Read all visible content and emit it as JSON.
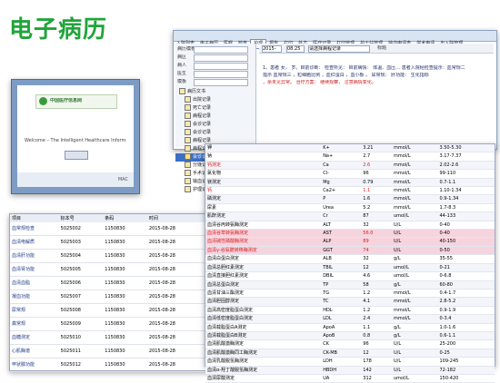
{
  "title": "电子病历",
  "topwin": {
    "menu": [
      "入院列表",
      "电子病历",
      "医嘱",
      "检查",
      "护理",
      "报告",
      "打印",
      "处方",
      "医疗记录",
      "打印管理",
      "护士站管理",
      "输血申请表",
      "学术申请",
      "出入院管理"
    ],
    "left_labels": [
      "病历模板",
      "病区",
      "病人",
      "医生",
      "模板"
    ],
    "tree": [
      "病历文书",
      "出院记录",
      "死亡记录",
      "病程记录",
      "会诊记录",
      "会诊记录",
      "病程记录",
      "病程记录",
      "会诊记录",
      "分娩记录",
      "手术记录",
      "输血记录",
      "护理记录"
    ],
    "doc_date1": "2015-",
    "doc_date2": "08:25",
    "doc_select": "请选择病程记录",
    "doc_right_label": "标题",
    "doc_line1": "1、患者  女，  岁。目前诊断：  检查所见：  目前病情：  体温、血压…  患者入院经检查提示：血常规二",
    "doc_line2": "指示 血常规三  ，粒细胞比例  ，血红蛋白  ，血小板  。  尿常规：  肝功能：  生化指标",
    "doc_line3": "  ，余未见异常。  治疗方案：  继续观察，  注意病情变化。"
  },
  "screenshot": {
    "brand": "中国医疗信息网",
    "caption": "Welcome – The Intelligent Healthcare Information",
    "footer": "MAC"
  },
  "right_table": {
    "rows": [
      [
        "钾",
        "K+",
        "3.21",
        "mmol/L",
        "3.50-5.30",
        false,
        false
      ],
      [
        "钠",
        "Na+",
        "2.7",
        "mmol/L",
        "3.17-7.37",
        false,
        false
      ],
      [
        "钙测定",
        "Ca",
        "2.6",
        "mmol/L",
        "2.02-2.6",
        true,
        false
      ],
      [
        "氯化物",
        "Cl-",
        "96",
        "mmol/L",
        "99-110",
        false,
        false
      ],
      [
        "镁测定",
        "Mg",
        "0.79",
        "mmol/L",
        "0.7-1.1",
        false,
        false
      ],
      [
        "钙",
        "Ca2+",
        "1.1",
        "mmol/L",
        "1.10-1.34",
        true,
        false
      ],
      [
        "磷测定",
        "P",
        "1.6",
        "mmol/L",
        "0.9-1.34",
        false,
        false
      ],
      [
        "尿素",
        "Urea",
        "5.2",
        "mmol/L",
        "1.7-8.3",
        false,
        false
      ],
      [
        "肌酐测定",
        "Cr",
        "87",
        "umol/L",
        "44-133",
        false,
        false
      ],
      [
        "血清谷丙转氨酶测定",
        "ALT",
        "32",
        "U/L",
        "0-40",
        false,
        false
      ],
      [
        "血清谷草转氨酶测定",
        "AST",
        "56.0",
        "U/L",
        "0-40",
        true,
        true
      ],
      [
        "血清碱性磷酸酶测定",
        "ALP",
        "89",
        "U/L",
        "40-150",
        true,
        true
      ],
      [
        "血清γ-谷氨酰转移酶测定",
        "GGT",
        "74",
        "U/L",
        "0-50",
        true,
        true
      ],
      [
        "血清白蛋白测定",
        "ALB",
        "32",
        "g/L",
        "35-55",
        false,
        false
      ],
      [
        "血清总胆红素测定",
        "TBIL",
        "12",
        "umol/L",
        "0-21",
        false,
        false
      ],
      [
        "血清直接胆红素测定",
        "DBIL",
        "4.6",
        "umol/L",
        "0-6.8",
        false,
        false
      ],
      [
        "血清总蛋白测定",
        "TP",
        "58",
        "g/L",
        "60-80",
        false,
        false
      ],
      [
        "血清甘油三酯测定",
        "TG",
        "1.2",
        "mmol/L",
        "0.4-1.7",
        false,
        false
      ],
      [
        "血清胆固醇测定",
        "TC",
        "4.1",
        "mmol/L",
        "2.8-5.2",
        false,
        false
      ],
      [
        "血清高密度脂蛋白测定",
        "HDL",
        "1.2",
        "mmol/L",
        "0.9-1.9",
        false,
        false
      ],
      [
        "血清低密度脂蛋白测定",
        "LDL",
        "2.4",
        "mmol/L",
        "0-3.4",
        false,
        false
      ],
      [
        "血清载脂蛋白A测定",
        "ApoA",
        "1.1",
        "g/L",
        "1.0-1.6",
        false,
        false
      ],
      [
        "血清载脂蛋白B测定",
        "ApoB",
        "0.8",
        "g/L",
        "0.6-1.1",
        false,
        false
      ],
      [
        "血清肌酸激酶测定",
        "CK",
        "96",
        "U/L",
        "25-200",
        false,
        false
      ],
      [
        "血清肌酸激酶同工酶测定",
        "CK-MB",
        "12",
        "U/L",
        "0-25",
        false,
        false
      ],
      [
        "血清乳酸脱氢酶测定",
        "LDH",
        "178",
        "U/L",
        "109-245",
        false,
        false
      ],
      [
        "血清α-羟丁酸脱氢酶测定",
        "HBDH",
        "142",
        "U/L",
        "72-182",
        false,
        false
      ],
      [
        "血清尿酸测定",
        "UA",
        "312",
        "umol/L",
        "150-420",
        false,
        false
      ]
    ]
  },
  "left_table": {
    "headers": [
      "项目",
      "标本号",
      "条码",
      "时间",
      "状态"
    ],
    "rows": [
      [
        "血常规检查",
        "5025002",
        "1150830",
        "2015-08-28",
        "已审"
      ],
      [
        "血清电解质",
        "5025003",
        "1150830",
        "2015-08-28",
        "已审"
      ],
      [
        "血清肝功能",
        "5025004",
        "1150830",
        "2015-08-28",
        "已审"
      ],
      [
        "血清肾功能",
        "5025005",
        "1150830",
        "2015-08-28",
        "已审"
      ],
      [
        "血清血脂",
        "5025006",
        "1150830",
        "2015-08-28",
        "已审"
      ],
      [
        "凝血功能",
        "5025007",
        "1150830",
        "2015-08-28",
        "已审"
      ],
      [
        "尿常规",
        "5025008",
        "1150830",
        "2015-08-28",
        "已审"
      ],
      [
        "粪常规",
        "5025009",
        "1150830",
        "2015-08-28",
        "已审"
      ],
      [
        "血糖测定",
        "5025010",
        "1150830",
        "2015-08-28",
        "已审"
      ],
      [
        "心肌酶谱",
        "5025011",
        "1150830",
        "2015-08-28",
        "已审"
      ],
      [
        "甲状腺功能",
        "5025012",
        "1150830",
        "2015-08-28",
        "已审"
      ]
    ]
  },
  "colors": {
    "title": "#1fa53a",
    "pink_row": "#f6d4de",
    "abnormal": "#d91c1c"
  }
}
